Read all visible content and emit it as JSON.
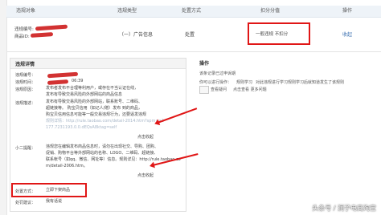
{
  "table": {
    "headers": [
      "违规对象",
      "违规类型",
      "处置方式",
      "扣分分值",
      "操作"
    ],
    "row": {
      "violation_id_label": "违规编号:",
      "product_label": "商品ID:",
      "type": "（一）广告信息",
      "handling": "处置",
      "score": "一般违规 不扣分",
      "action": "收起"
    }
  },
  "details": {
    "title": "违规详情",
    "id_label": "违规编号：",
    "time_label": "违规时间：",
    "time_suffix": "06:39",
    "reason_label": "违规原因：",
    "reason_text": "发布者发布不合理等利用户，或存在不当认证在线，",
    "reason_text2": "发布有导致交易风险的外部网站的商品信息",
    "explain_label": "违规描述：",
    "explain_text": "发布有导致交易风险的外部网站，联系账号、二维码、",
    "explain_text2": "超链接等。  购宝贝信用（如记人/赠）发布 到的商品，",
    "explain_text3": "购宝贝信用信息可能等一般交易违规行为，还要逼发违规",
    "explain_text4": "规则详情：http://rule.taobao.com/detail-2014.htm?spm=a2",
    "explain_text5": "177.7231193.0.0.dEQsA8ktag=self",
    "expand_1": "点击收起",
    "tips_label": "小二提醒：",
    "tips_text": "违规您在编辑发布商品信息时，请勿在出现社交、导购、团购、",
    "tips_text2": "促销、购物平台等外部网站的名称、LOGO、二维码、超链接、",
    "tips_text3": "联系帐号（如qq、微信、网址等）信息。规则详见：http://rule.taobao.co",
    "tips_text4": "m/detail-2006.htm。",
    "expand_2": "点击收起",
    "method_label": "处置方式：",
    "method_value": "立即下架商品",
    "related_label": "处罚建议：",
    "related_link": "我有话说"
  },
  "operations": {
    "title": "操作",
    "status": "该条记录已过申诉期",
    "next_label": "你可以进行操作：",
    "rule_link": "规则学习",
    "next_text": "对此违规进行学习规则学习后就知道发生了该规则",
    "more_link": "查看疑问",
    "more_text": "点击查看 更多问题"
  },
  "watermark": "头条号 / 洞子电商淘宝"
}
